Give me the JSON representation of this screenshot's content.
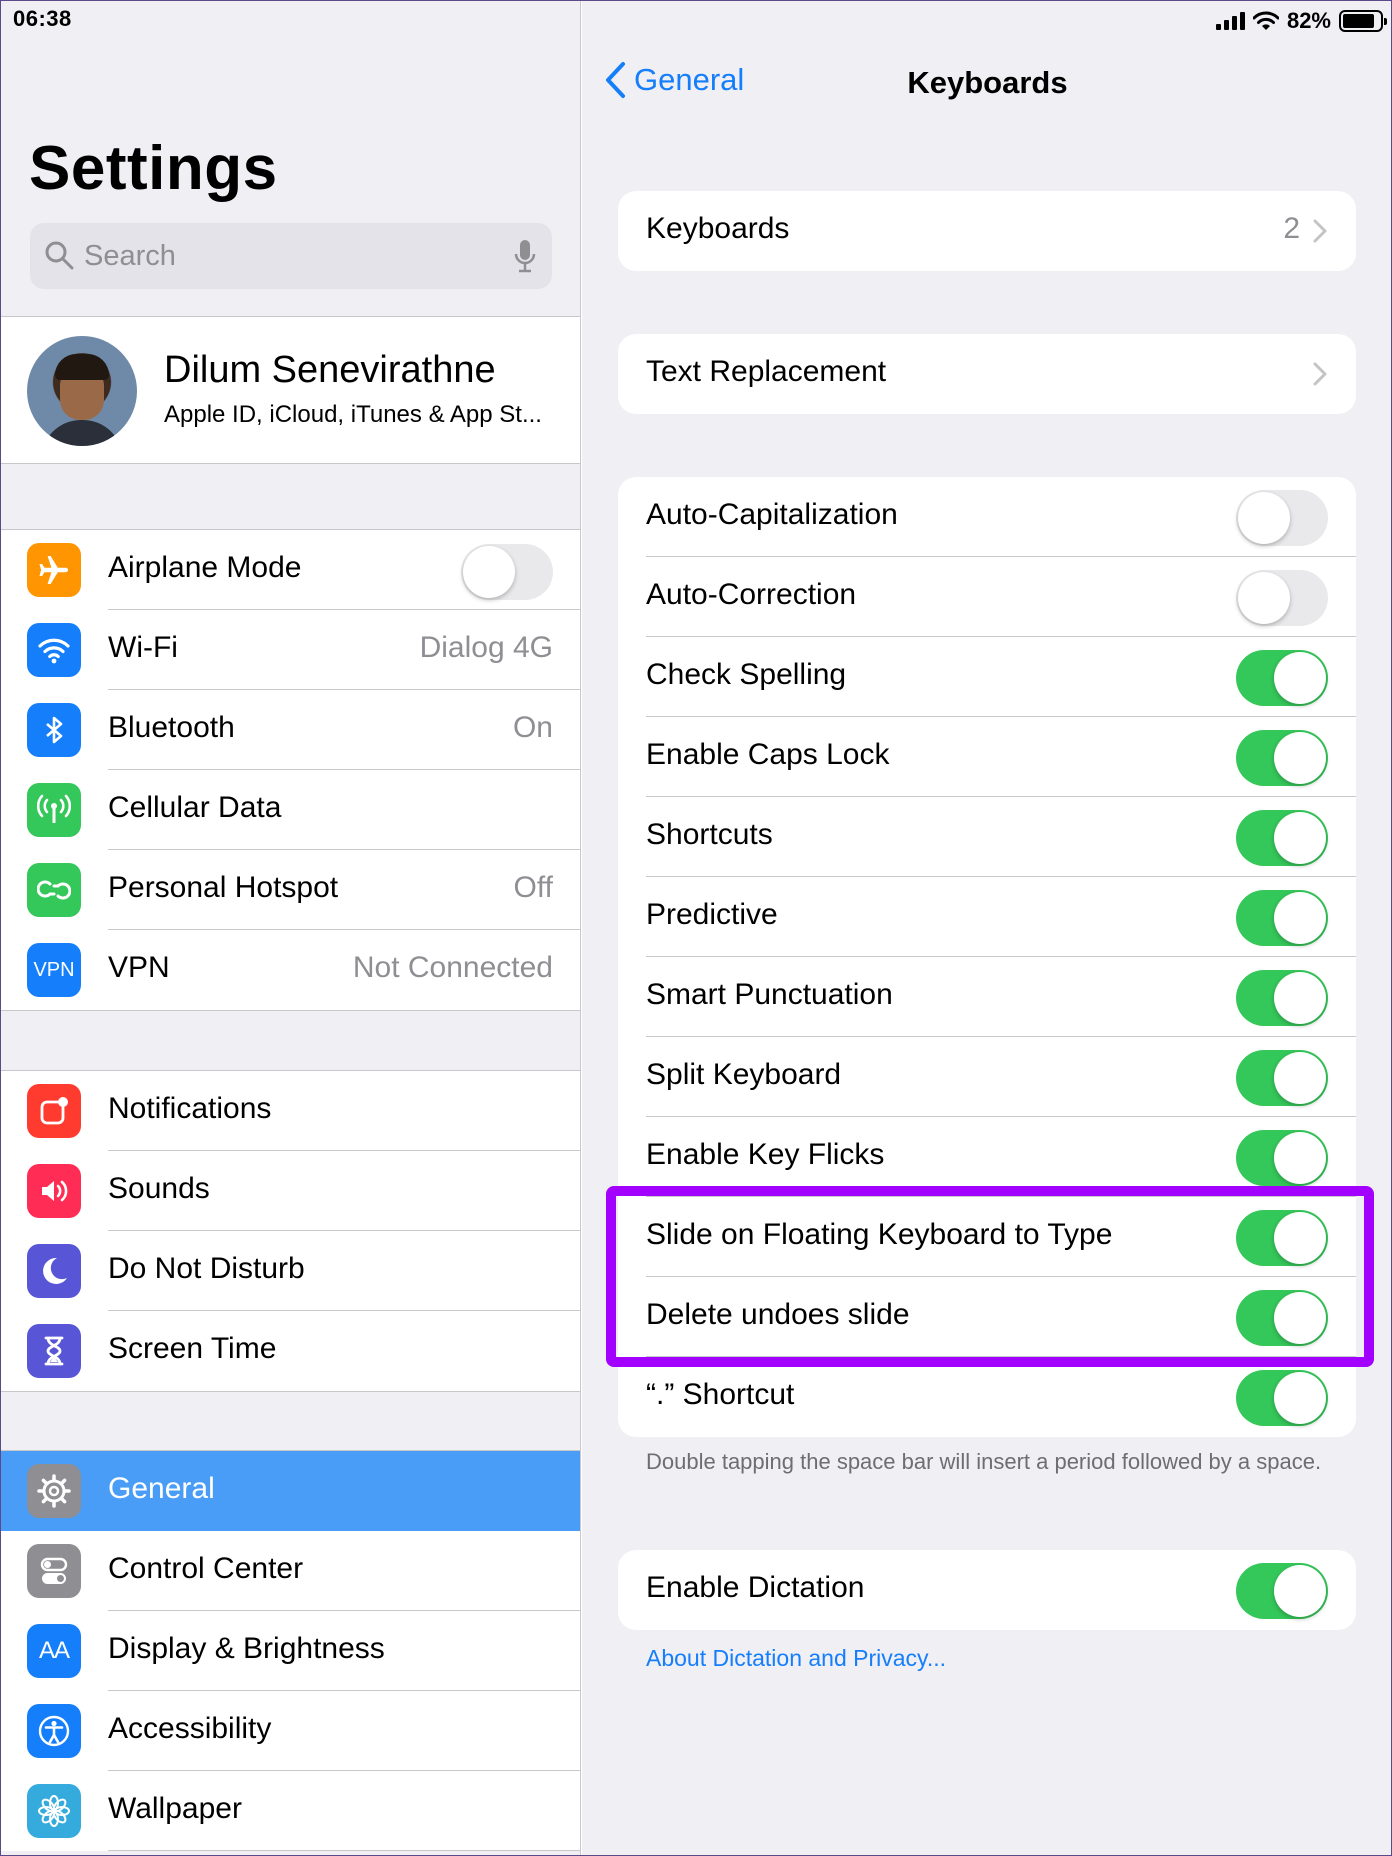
{
  "status_bar": {
    "time": "06:38",
    "battery_percent": "82%",
    "battery_level": 0.82
  },
  "sidebar": {
    "title": "Settings",
    "search_placeholder": "Search",
    "profile": {
      "name": "Dilum Senevirathne",
      "subtitle": "Apple ID, iCloud, iTunes & App St..."
    },
    "group1": [
      {
        "label": "Airplane Mode",
        "value": "",
        "icon": "airplane-icon",
        "color": "#ff9500",
        "toggle": false
      },
      {
        "label": "Wi-Fi",
        "value": "Dialog 4G",
        "icon": "wifi-icon",
        "color": "#147efb"
      },
      {
        "label": "Bluetooth",
        "value": "On",
        "icon": "bluetooth-icon",
        "color": "#147efb"
      },
      {
        "label": "Cellular Data",
        "value": "",
        "icon": "antenna-icon",
        "color": "#34c759"
      },
      {
        "label": "Personal Hotspot",
        "value": "Off",
        "icon": "hotspot-icon",
        "color": "#34c759"
      },
      {
        "label": "VPN",
        "value": "Not Connected",
        "icon": "vpn-icon",
        "color": "#147efb",
        "icon_text": "VPN"
      }
    ],
    "group2": [
      {
        "label": "Notifications",
        "icon": "notifications-icon",
        "color": "#ff3b30"
      },
      {
        "label": "Sounds",
        "icon": "speaker-icon",
        "color": "#ff2d55"
      },
      {
        "label": "Do Not Disturb",
        "icon": "moon-icon",
        "color": "#5856d6"
      },
      {
        "label": "Screen Time",
        "icon": "hourglass-icon",
        "color": "#5856d6"
      }
    ],
    "group3": [
      {
        "label": "General",
        "icon": "gear-icon",
        "color": "#8e8e93",
        "selected": true
      },
      {
        "label": "Control Center",
        "icon": "switches-icon",
        "color": "#8e8e93"
      },
      {
        "label": "Display & Brightness",
        "icon": "text-size-icon",
        "color": "#147efb",
        "icon_text": "AA"
      },
      {
        "label": "Accessibility",
        "icon": "accessibility-icon",
        "color": "#147efb"
      },
      {
        "label": "Wallpaper",
        "icon": "flower-icon",
        "color": "#35aadc"
      }
    ]
  },
  "detail": {
    "back_label": "General",
    "title": "Keyboards",
    "keyboards_row": {
      "label": "Keyboards",
      "value": "2"
    },
    "text_replacement_row": {
      "label": "Text Replacement"
    },
    "toggles": [
      {
        "label": "Auto-Capitalization",
        "on": false
      },
      {
        "label": "Auto-Correction",
        "on": false
      },
      {
        "label": "Check Spelling",
        "on": true
      },
      {
        "label": "Enable Caps Lock",
        "on": true
      },
      {
        "label": "Shortcuts",
        "on": true
      },
      {
        "label": "Predictive",
        "on": true
      },
      {
        "label": "Smart Punctuation",
        "on": true
      },
      {
        "label": "Split Keyboard",
        "on": true
      },
      {
        "label": "Enable Key Flicks",
        "on": true
      },
      {
        "label": "Slide on Floating Keyboard to Type",
        "on": true
      },
      {
        "label": "Delete undoes slide",
        "on": true
      },
      {
        "label": "“.” Shortcut",
        "on": true
      }
    ],
    "period_footnote": "Double tapping the space bar will insert a period followed by a space.",
    "dictation": {
      "label": "Enable Dictation",
      "on": true
    },
    "dictation_link": "About Dictation and Privacy..."
  },
  "colors": {
    "accent": "#147efb",
    "toggle_on": "#34c759",
    "selected_row": "#4a9df7",
    "highlight": "#a200ff"
  }
}
